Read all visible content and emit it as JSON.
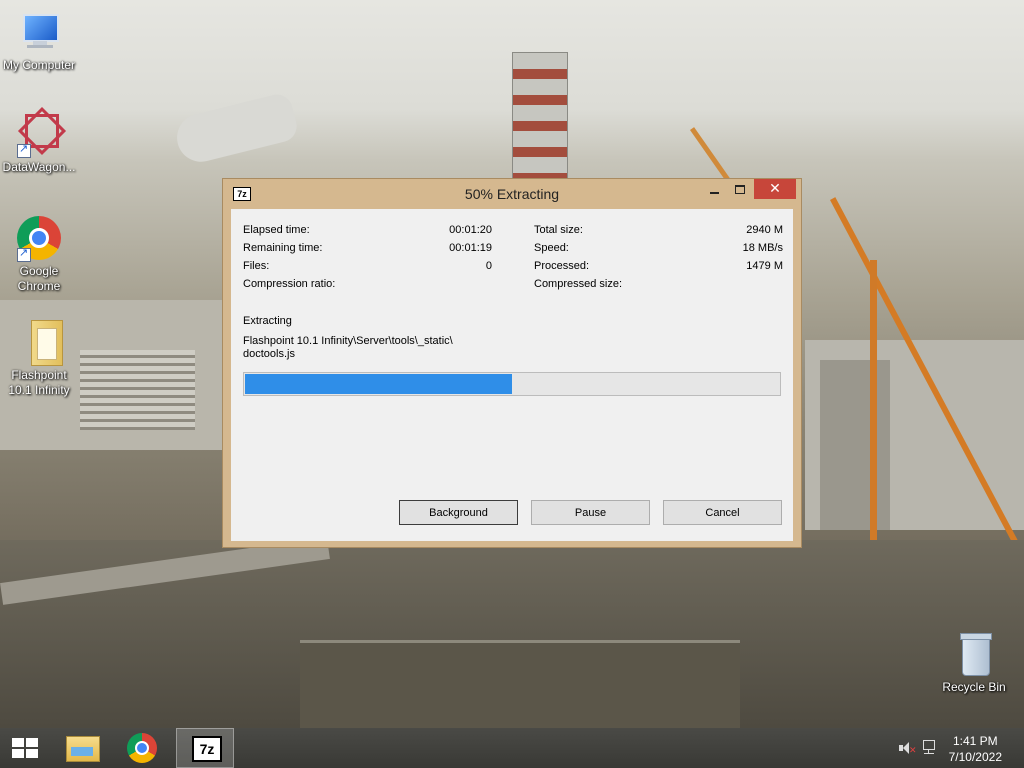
{
  "desktop": {
    "icons": [
      {
        "label": "My Computer"
      },
      {
        "label": "DataWagon..."
      },
      {
        "label": "Google Chrome"
      },
      {
        "label": "Flashpoint 10.1 Infinity"
      },
      {
        "label": "Recycle Bin"
      }
    ]
  },
  "dialog": {
    "app_icon": "7z",
    "title": "50% Extracting",
    "close_glyph": "✕",
    "stats_left": [
      {
        "label": "Elapsed time:",
        "value": "00:01:20"
      },
      {
        "label": "Remaining time:",
        "value": "00:01:19"
      },
      {
        "label": "Files:",
        "value": "0"
      },
      {
        "label": "Compression ratio:",
        "value": ""
      }
    ],
    "stats_right": [
      {
        "label": "Total size:",
        "value": "2940 M"
      },
      {
        "label": "Speed:",
        "value": "18 MB/s"
      },
      {
        "label": "Processed:",
        "value": "1479 M"
      },
      {
        "label": "Compressed size:",
        "value": ""
      }
    ],
    "status_label": "Extracting",
    "current_path_line1": "Flashpoint 10.1 Infinity\\Server\\tools\\_static\\",
    "current_path_line2": "doctools.js",
    "progress_fraction": 0.5,
    "buttons": {
      "background": "Background",
      "pause": "Pause",
      "cancel": "Cancel"
    }
  },
  "taskbar": {
    "apps": [
      "start-icon",
      "file-explorer-icon",
      "chrome-icon",
      "7zip-icon"
    ],
    "active_app_label": "7z",
    "clock_time": "1:41 PM",
    "clock_date": "7/10/2022"
  },
  "colors": {
    "dialog_frame": "#d5b88f",
    "progress_fill": "#2f8ee8",
    "close_button": "#c7463a",
    "taskbar": "#3f3f3b"
  }
}
